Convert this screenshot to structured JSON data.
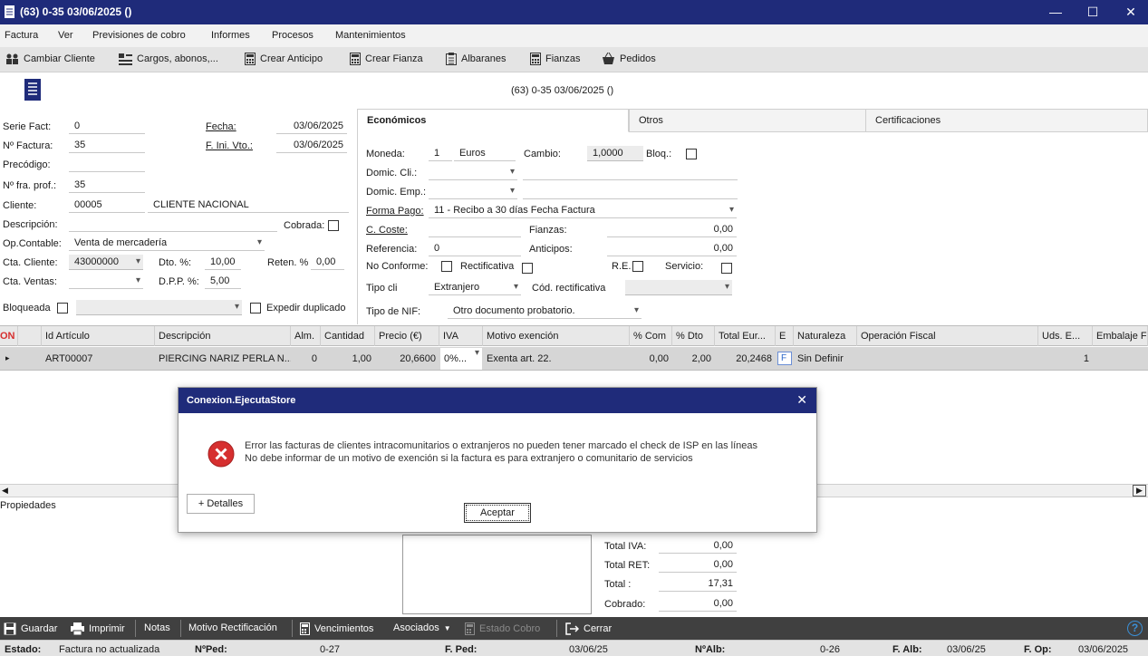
{
  "window": {
    "title": "(63) 0-35  03/06/2025  ()",
    "minimize_icon": "minimize-icon",
    "maximize_icon": "maximize-icon",
    "close_icon": "close-icon"
  },
  "menu": [
    "Factura",
    "Ver",
    "Previsiones de cobro",
    "Informes",
    "Procesos",
    "Mantenimientos"
  ],
  "toolbar": [
    {
      "label": "Cambiar Cliente",
      "icon": "users-icon"
    },
    {
      "label": "Cargos, abonos,...",
      "icon": "list-icon"
    },
    {
      "label": "Crear Anticipo",
      "icon": "calculator-icon"
    },
    {
      "label": "Crear Fianza",
      "icon": "calculator-icon"
    },
    {
      "label": "Albaranes",
      "icon": "clipboard-icon"
    },
    {
      "label": "Fianzas",
      "icon": "calculator-icon"
    },
    {
      "label": "Pedidos",
      "icon": "basket-icon"
    }
  ],
  "header": {
    "doc_title": "(63) 0-35  03/06/2025  ()"
  },
  "form": {
    "serie_fact_label": "Serie Fact:",
    "serie_fact": "0",
    "num_factura_label": "Nº Factura:",
    "num_factura": "35",
    "precodigo_label": "Precódigo:",
    "precodigo": "",
    "num_fra_prof_label": "Nº fra. prof.:",
    "num_fra_prof": "35",
    "cliente_label": "Cliente:",
    "cliente_code": "00005",
    "cliente_name": "CLIENTE NACIONAL",
    "descripcion_label": "Descripción:",
    "descripcion": "",
    "cobrada_label": "Cobrada:",
    "op_contable_label": "Op.Contable:",
    "op_contable": "Venta de mercadería",
    "cta_cliente_label": "Cta. Cliente:",
    "cta_cliente": "43000000",
    "dto_label": "Dto. %:",
    "dto": "10,00",
    "reten_label": "Reten. %",
    "reten": "0,00",
    "cta_ventas_label": "Cta. Ventas:",
    "cta_ventas": "",
    "dpp_label": "D.P.P. %:",
    "dpp": "5,00",
    "bloqueada_label": "Bloqueada",
    "expedir_label": "Expedir duplicado",
    "fecha_label": "Fecha:",
    "fecha": "03/06/2025",
    "f_ini_vto_label": "F. Ini. Vto.:",
    "f_ini_vto": "03/06/2025"
  },
  "tabs": [
    "Económicos",
    "Otros",
    "Certificaciones"
  ],
  "economicos": {
    "moneda_label": "Moneda:",
    "moneda_code": "1",
    "moneda_name": "Euros",
    "cambio_label": "Cambio:",
    "cambio": "1,0000",
    "bloq_label": "Bloq.:",
    "domic_cli_label": "Domic. Cli.:",
    "domic_emp_label": "Domic. Emp.:",
    "forma_pago_label": "Forma Pago:",
    "forma_pago": "11 - Recibo a 30 días Fecha Factura",
    "c_coste_label": "C. Coste:",
    "fianzas_label": "Fianzas:",
    "fianzas": "0,00",
    "referencia_label": "Referencia:",
    "referencia": "0",
    "anticipos_label": "Anticipos:",
    "anticipos": "0,00",
    "no_conforme_label": "No Conforme:",
    "rectificativa_label": "Rectificativa",
    "re_label": "R.E.",
    "servicio_label": "Servicio:",
    "tipo_cli_label": "Tipo cli",
    "tipo_cli": "Extranjero",
    "cod_rect_label": "Cód. rectificativa",
    "tipo_nif_label": "Tipo de NIF:",
    "tipo_nif": "Otro documento probatorio."
  },
  "grid": {
    "first_col": "ON",
    "columns": [
      "Id Artículo",
      "Descripción",
      "Alm.",
      "Cantidad",
      "Precio (€)",
      "IVA",
      "Motivo exención",
      "% Com",
      "% Dto",
      "Total Eur...",
      "E",
      "Naturaleza",
      "Operación Fiscal",
      "Uds. E...",
      "Embalaje F"
    ],
    "rows": [
      [
        "ART00007",
        "PIERCING NARIZ PERLA N...",
        "0",
        "1,00",
        "20,6600",
        "0%...",
        "Exenta art. 22.",
        "0,00",
        "2,00",
        "20,2468",
        "F",
        "Sin Definir",
        "",
        "1",
        ""
      ]
    ]
  },
  "propiedades_label": "Propiedades",
  "totals": [
    {
      "label": "Total IVA:",
      "value": "0,00"
    },
    {
      "label": "Total RET:",
      "value": "0,00"
    },
    {
      "label": "Total :",
      "value": "17,31"
    },
    {
      "label": "Cobrado:",
      "value": "0,00"
    }
  ],
  "dialog": {
    "title": "Conexion.EjecutaStore",
    "line1": "Error las facturas de  clientes intracomunitarios o extranjeros  no pueden tener marcado el check de ISP en las líneas",
    "line2": "No debe informar de un motivo de exención si la factura es para extranjero o comunitario de servicios",
    "details": "+ Detalles",
    "ok": "Aceptar"
  },
  "bottom": {
    "guardar": "Guardar",
    "imprimir": "Imprimir",
    "notas": "Notas",
    "motivo": "Motivo Rectificación",
    "vencimientos": "Vencimientos",
    "asociados": "Asociados",
    "estado_cobro": "Estado Cobro",
    "cerrar": "Cerrar",
    "help": "?"
  },
  "status": {
    "estado_label": "Estado:",
    "estado": "Factura no actualizada",
    "nped_label": "NºPed:",
    "nped": "0-27",
    "fped_label": "F. Ped:",
    "fped": "03/06/25",
    "nalb_label": "NºAlb:",
    "nalb": "0-26",
    "falb_label": "F. Alb:",
    "falb": "03/06/25",
    "fop_label": "F. Op:",
    "fop": "03/06/2025"
  },
  "colors": {
    "titlebar": "#1f2b7a",
    "bottombar": "#404040",
    "error": "#d62f2f"
  }
}
